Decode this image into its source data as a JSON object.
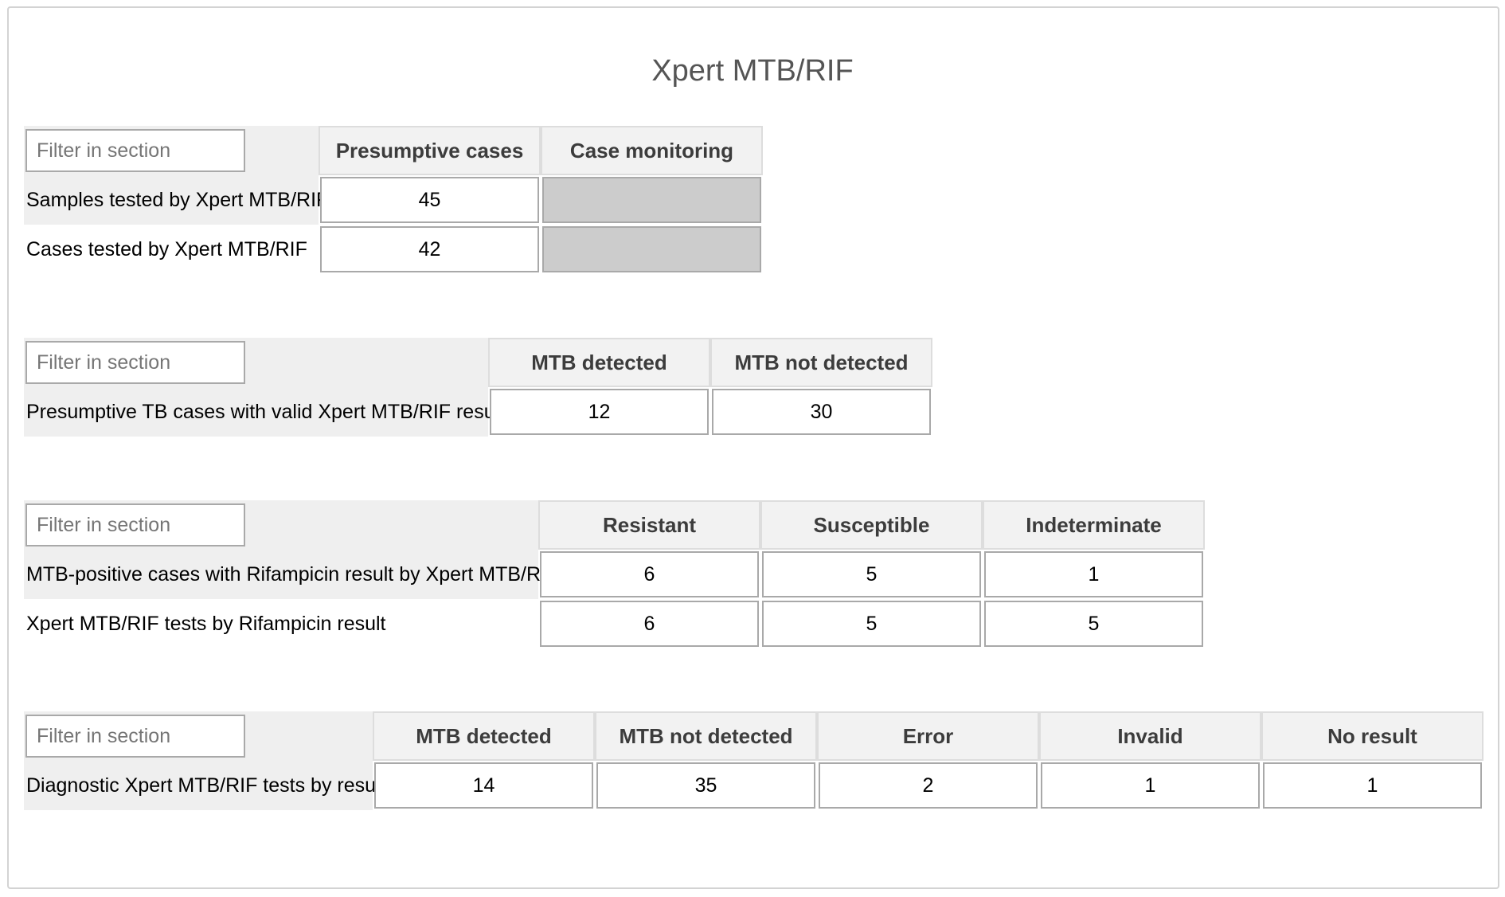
{
  "title": "Xpert MTB/RIF",
  "filter_placeholder": "Filter in section",
  "sections": [
    {
      "headers": [
        "Presumptive cases",
        "Case monitoring"
      ],
      "rows": [
        {
          "label": "Samples tested by Xpert MTB/RIF",
          "values": [
            "45",
            ""
          ],
          "disabled": [
            false,
            true
          ]
        },
        {
          "label": "Cases tested by Xpert MTB/RIF",
          "values": [
            "42",
            ""
          ],
          "disabled": [
            false,
            true
          ]
        }
      ]
    },
    {
      "headers": [
        "MTB detected",
        "MTB not detected"
      ],
      "rows": [
        {
          "label": "Presumptive TB cases with valid Xpert MTB/RIF result",
          "values": [
            "12",
            "30"
          ]
        }
      ]
    },
    {
      "headers": [
        "Resistant",
        "Susceptible",
        "Indeterminate"
      ],
      "rows": [
        {
          "label": "MTB-positive cases with Rifampicin result by Xpert MTB/RIF",
          "values": [
            "6",
            "5",
            "1"
          ]
        },
        {
          "label": "Xpert MTB/RIF tests by Rifampicin result",
          "values": [
            "6",
            "5",
            "5"
          ]
        }
      ]
    },
    {
      "headers": [
        "MTB detected",
        "MTB not detected",
        "Error",
        "Invalid",
        "No result"
      ],
      "rows": [
        {
          "label": "Diagnostic Xpert MTB/RIF tests by result",
          "values": [
            "14",
            "35",
            "2",
            "1",
            "1"
          ]
        }
      ]
    }
  ]
}
